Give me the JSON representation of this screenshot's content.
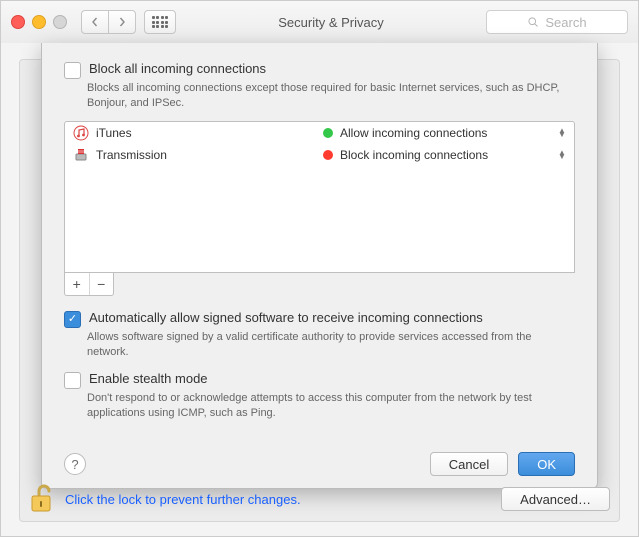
{
  "window": {
    "title": "Security & Privacy"
  },
  "toolbar": {
    "search_placeholder": "Search"
  },
  "sheet": {
    "block_all": {
      "label": "Block all incoming connections",
      "desc": "Blocks all incoming connections except those required for basic Internet services,  such as DHCP, Bonjour, and IPSec.",
      "checked": false
    },
    "apps": [
      {
        "name": "iTunes",
        "status": "allow",
        "status_label": "Allow incoming connections"
      },
      {
        "name": "Transmission",
        "status": "block",
        "status_label": "Block incoming connections"
      }
    ],
    "auto_allow": {
      "label": "Automatically allow signed software to receive incoming connections",
      "desc": "Allows software signed by a valid certificate authority to provide services accessed from the network.",
      "checked": true
    },
    "stealth": {
      "label": "Enable stealth mode",
      "desc": "Don't respond to or acknowledge attempts to access this computer from the network by test applications using ICMP, such as Ping.",
      "checked": false
    },
    "buttons": {
      "cancel": "Cancel",
      "ok": "OK"
    }
  },
  "bottom": {
    "lock_text": "Click the lock to prevent further changes.",
    "advanced": "Advanced…"
  }
}
